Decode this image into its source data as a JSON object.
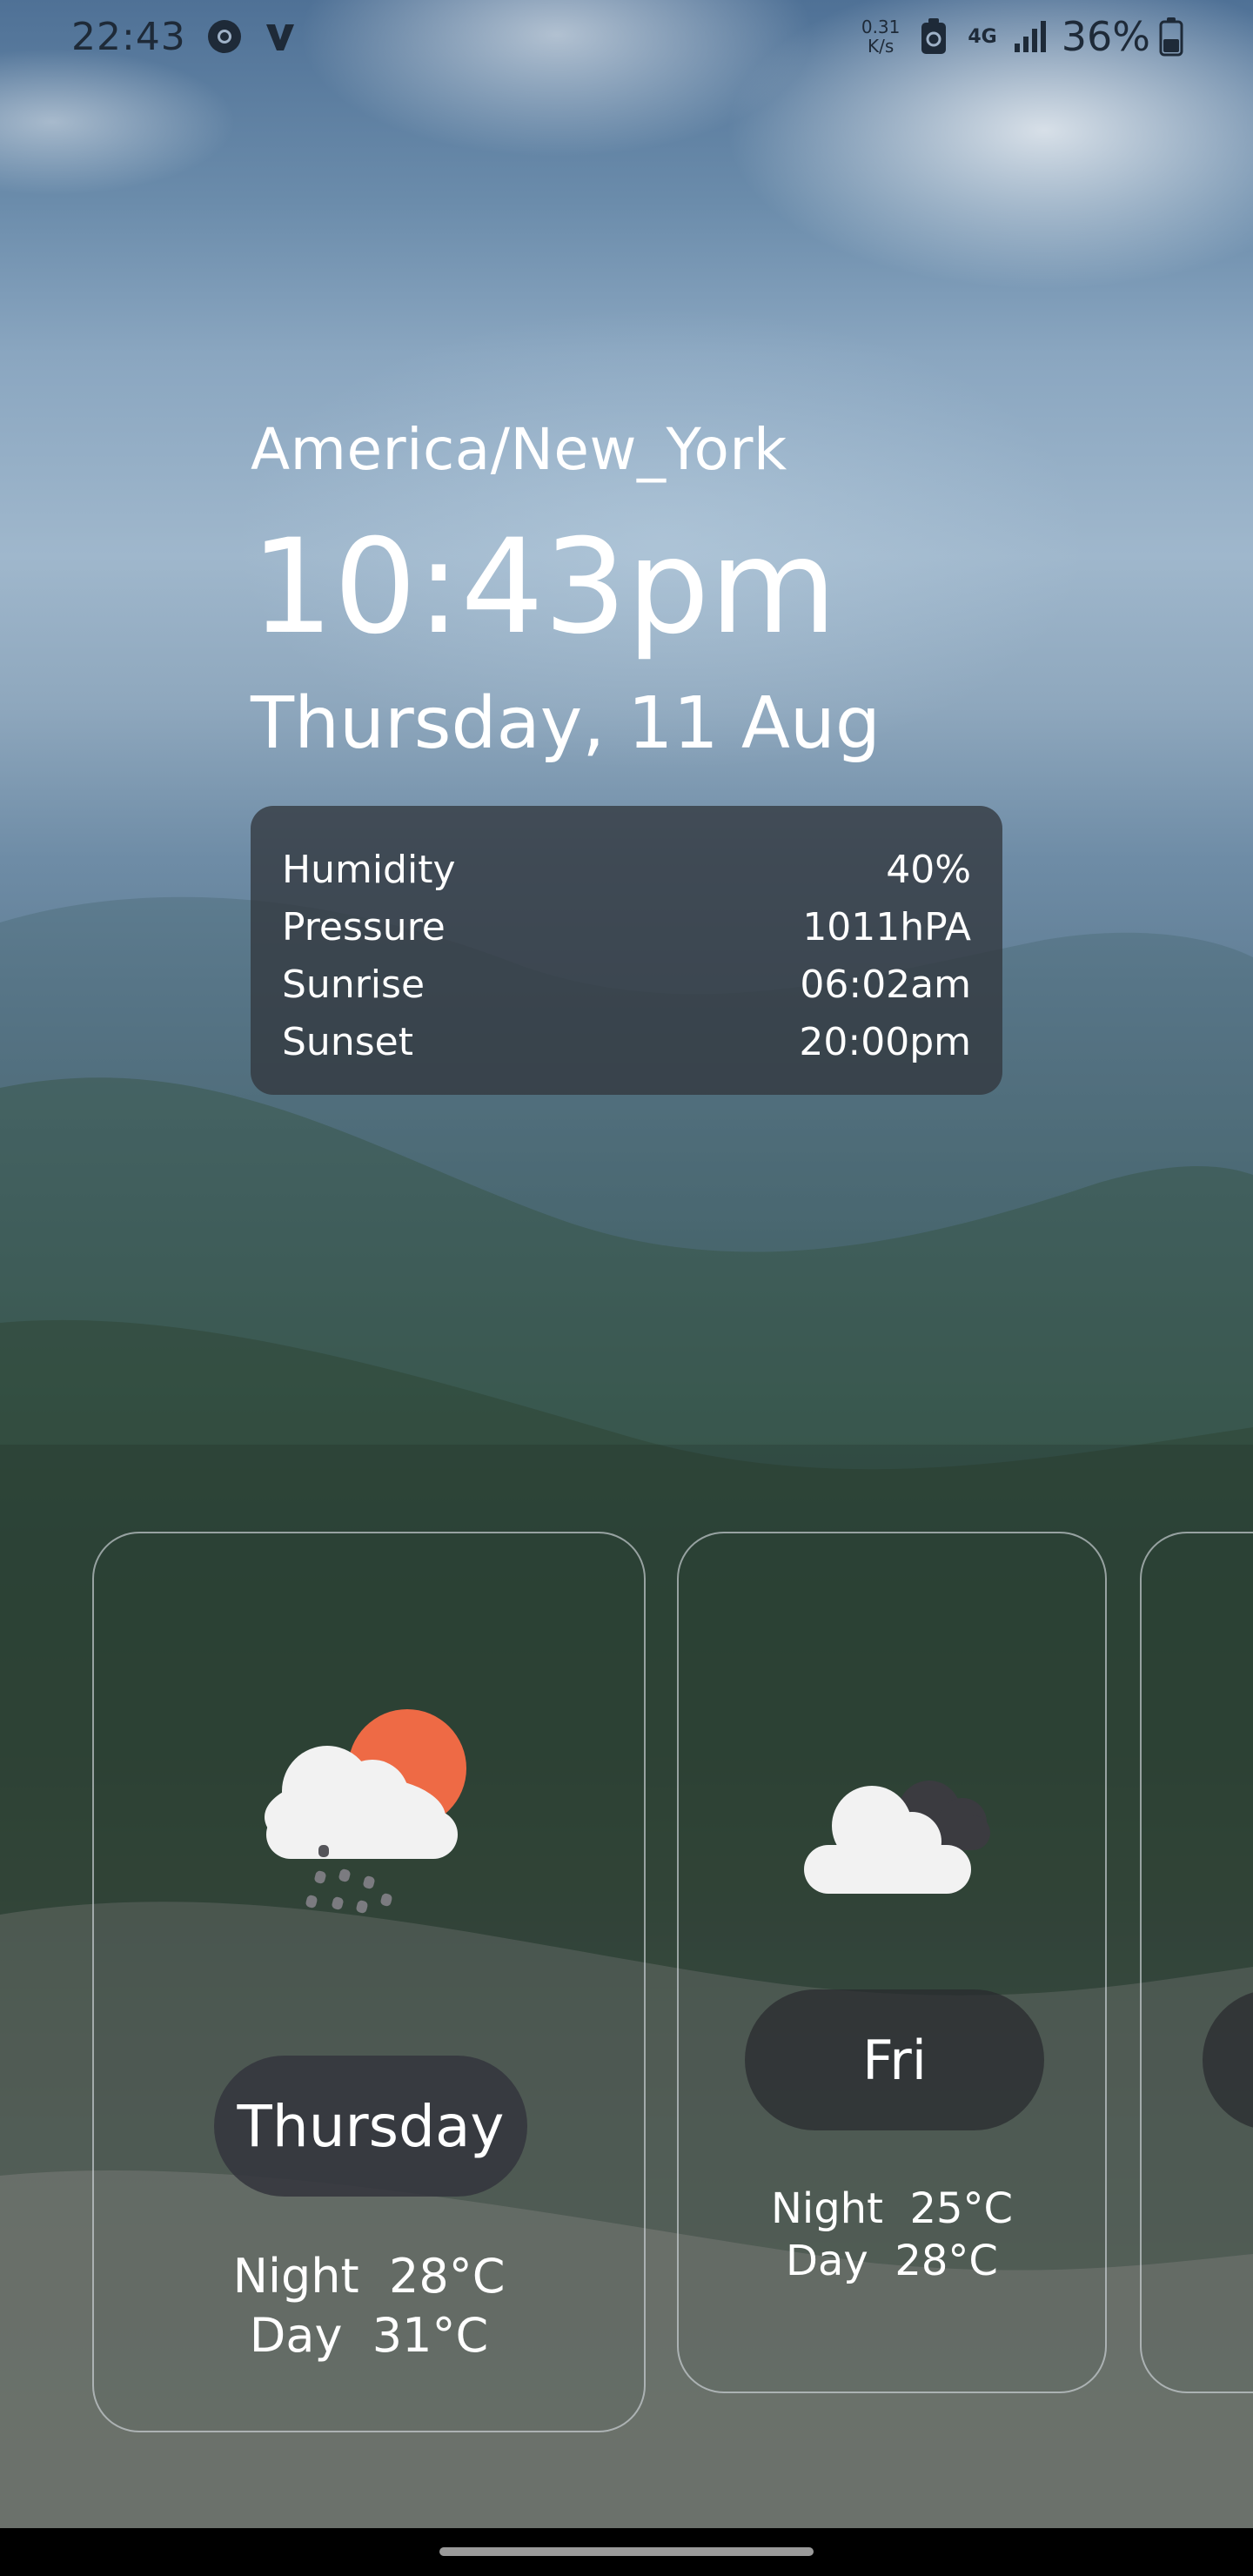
{
  "status_bar": {
    "time": "22:43",
    "speed_value": "0.31",
    "speed_unit": "K/s",
    "network": "4G",
    "battery": "36%"
  },
  "header": {
    "location": "America/New_York",
    "time": "10:43pm",
    "date": "Thursday, 11 Aug"
  },
  "details": [
    {
      "label": "Humidity",
      "value": "40%"
    },
    {
      "label": "Pressure",
      "value": "1011hPA"
    },
    {
      "label": "Sunrise",
      "value": "06:02am"
    },
    {
      "label": "Sunset",
      "value": "20:00pm"
    }
  ],
  "forecast": [
    {
      "day": "Thursday",
      "night_label": "Night",
      "night_temp": "28°C",
      "day_label": "Day",
      "day_temp": "31°C",
      "icon": "sun-cloud-rain-icon"
    },
    {
      "day": "Fri",
      "night_label": "Night",
      "night_temp": "25°C",
      "day_label": "Day",
      "day_temp": "28°C",
      "icon": "cloudy-icon"
    }
  ],
  "colors": {
    "sun": "#ee6a45",
    "cloud": "#f2f2f2",
    "dark_cloud": "#3b3b40",
    "card_panel": "#32373e"
  }
}
